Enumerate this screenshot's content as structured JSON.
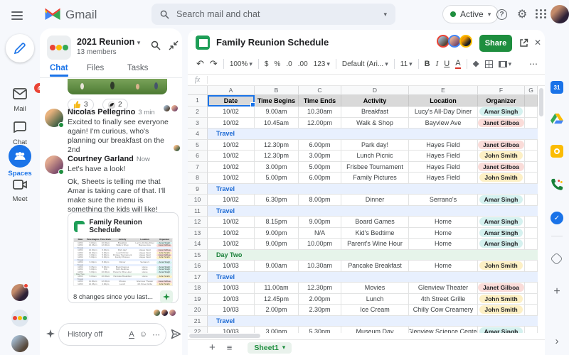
{
  "topbar": {
    "product": "Gmail",
    "search_placeholder": "Search mail and chat",
    "status": "Active"
  },
  "left_rail": {
    "mail_badge": "4",
    "items": [
      {
        "label": "Mail",
        "icon": "mail-icon"
      },
      {
        "label": "Chat",
        "icon": "chat-icon"
      },
      {
        "label": "Spaces",
        "icon": "spaces-icon",
        "active": true
      },
      {
        "label": "Meet",
        "icon": "meet-icon"
      }
    ]
  },
  "chat": {
    "space_name": "2021 Reunion",
    "members": "13 members",
    "tabs": [
      "Chat",
      "Files",
      "Tasks"
    ],
    "active_tab": "Chat",
    "reactions": [
      {
        "emoji": "thumbs-up",
        "count": "3"
      },
      {
        "emoji": "soccer-ball",
        "count": "2"
      }
    ],
    "messages": [
      {
        "author": "Nicolas Pellegrino",
        "time": "3 min",
        "text": "Excited to finally see everyone again! I'm curious, who's planning our breakfast on the 2nd"
      },
      {
        "author": "Courtney Garland",
        "time": "Now",
        "text": "Let's have a look!",
        "text2": "Ok, Sheets is telling me that Amar is taking care of that. I'll make sure the menu is something the kids will like!"
      }
    ],
    "card": {
      "title": "Family Reunion Schedule",
      "footer": "8 changes since you last..."
    },
    "input_placeholder": "History off"
  },
  "sheet": {
    "title": "Family Reunion Schedule",
    "share_label": "Share",
    "toolbar": {
      "zoom": "100%",
      "currency": "$",
      "percent": "%",
      "dec0": ".0",
      "dec00": ".00",
      "more_formats": "123",
      "font": "Default (Ari...",
      "size": "11",
      "bold": "B",
      "italic": "I",
      "underline": "U",
      "color": "A"
    },
    "formula_fx": "fx",
    "columns": [
      "A",
      "B",
      "C",
      "D",
      "E",
      "F",
      "G"
    ],
    "header_row": [
      "Date",
      "Time Begins",
      "Time Ends",
      "Activity",
      "Location",
      "Organizer"
    ],
    "rows": [
      {
        "n": "2",
        "cells": [
          "10/02",
          "9.00am",
          "10.30am",
          "Breakfast",
          "Lucy's All-Day Diner",
          "Amar Singh"
        ]
      },
      {
        "n": "3",
        "cells": [
          "10/02",
          "10.45am",
          "12.00pm",
          "Walk & Shop",
          "Bayview Ave",
          "Janet Gilboa"
        ]
      },
      {
        "n": "4",
        "band": "Travel",
        "type": "travel"
      },
      {
        "n": "5",
        "cells": [
          "10/02",
          "12.30pm",
          "6.00pm",
          "Park day!",
          "Hayes Field",
          "Janet Gilboa"
        ]
      },
      {
        "n": "6",
        "cells": [
          "10/02",
          "12.30pm",
          "3.00pm",
          "Lunch Picnic",
          "Hayes Field",
          "John Smith"
        ]
      },
      {
        "n": "7",
        "cells": [
          "10/02",
          "3.00pm",
          "5.00pm",
          "Frisbee Tournament",
          "Hayes Field",
          "Janet Gilboa"
        ]
      },
      {
        "n": "8",
        "cells": [
          "10/02",
          "5.00pm",
          "6.00pm",
          "Family Pictures",
          "Hayes Field",
          "John Smith"
        ]
      },
      {
        "n": "9",
        "band": "Travel",
        "type": "travel"
      },
      {
        "n": "10",
        "cells": [
          "10/02",
          "6.30pm",
          "8.00pm",
          "Dinner",
          "Serrano's",
          "Amar Singh"
        ]
      },
      {
        "n": "11",
        "band": "Travel",
        "type": "travel"
      },
      {
        "n": "12",
        "cells": [
          "10/02",
          "8.15pm",
          "9.00pm",
          "Board Games",
          "Home",
          "Amar Singh"
        ]
      },
      {
        "n": "13",
        "cells": [
          "10/02",
          "9.00pm",
          "N/A",
          "Kid's Bedtime",
          "Home",
          "Amar Singh"
        ]
      },
      {
        "n": "14",
        "cells": [
          "10/02",
          "9.00pm",
          "10.00pm",
          "Parent's Wine Hour",
          "Home",
          "Amar Singh"
        ]
      },
      {
        "n": "15",
        "band": "Day Two",
        "type": "day"
      },
      {
        "n": "16",
        "cells": [
          "10/03",
          "9.00am",
          "10.30am",
          "Pancake Breakfast",
          "Home",
          "John Smith"
        ]
      },
      {
        "n": "17",
        "band": "Travel",
        "type": "travel"
      },
      {
        "n": "18",
        "cells": [
          "10/03",
          "11.00am",
          "12.30pm",
          "Movies",
          "Glenview Theater",
          "Janet Gilboa"
        ]
      },
      {
        "n": "19",
        "cells": [
          "10/03",
          "12.45pm",
          "2.00pm",
          "Lunch",
          "4th Street Grille",
          "John Smith"
        ]
      },
      {
        "n": "20",
        "cells": [
          "10/03",
          "2.00pm",
          "2.30pm",
          "Ice Cream",
          "Chilly Cow Creamery",
          "John Smith"
        ]
      },
      {
        "n": "21",
        "band": "Travel",
        "type": "travel"
      },
      {
        "n": "22",
        "cells": [
          "10/03",
          "3.00pm",
          "5.30pm",
          "Museum Day",
          "Glenview Science Center",
          "Amar Singh"
        ]
      }
    ],
    "organizer_colors": {
      "Amar Singh": "#d5f1ef",
      "Janet Gilboa": "#fadcd9",
      "John Smith": "#fdf0c5"
    },
    "band_colors": {
      "travel_bg": "#e8f0fe",
      "travel_text": "#1967d2",
      "day_bg": "#e6f4ea",
      "day_text": "#188038"
    },
    "tab_name": "Sheet1"
  },
  "right_rail_apps": [
    "calendar-icon",
    "drive-icon",
    "keep-icon",
    "voice-icon",
    "tasks-icon",
    "addons-icon",
    "get-addons-icon"
  ],
  "glyphs": {
    "caret": "▾",
    "close": "✕",
    "more": "⋯",
    "undo": "↶",
    "redo": "↷",
    "plus": "+",
    "chevron": "›",
    "smiley": "☺",
    "gear": "⚙",
    "sheets_list": "≡",
    "cal_day": "31",
    "check": "✓",
    "q": "?"
  }
}
